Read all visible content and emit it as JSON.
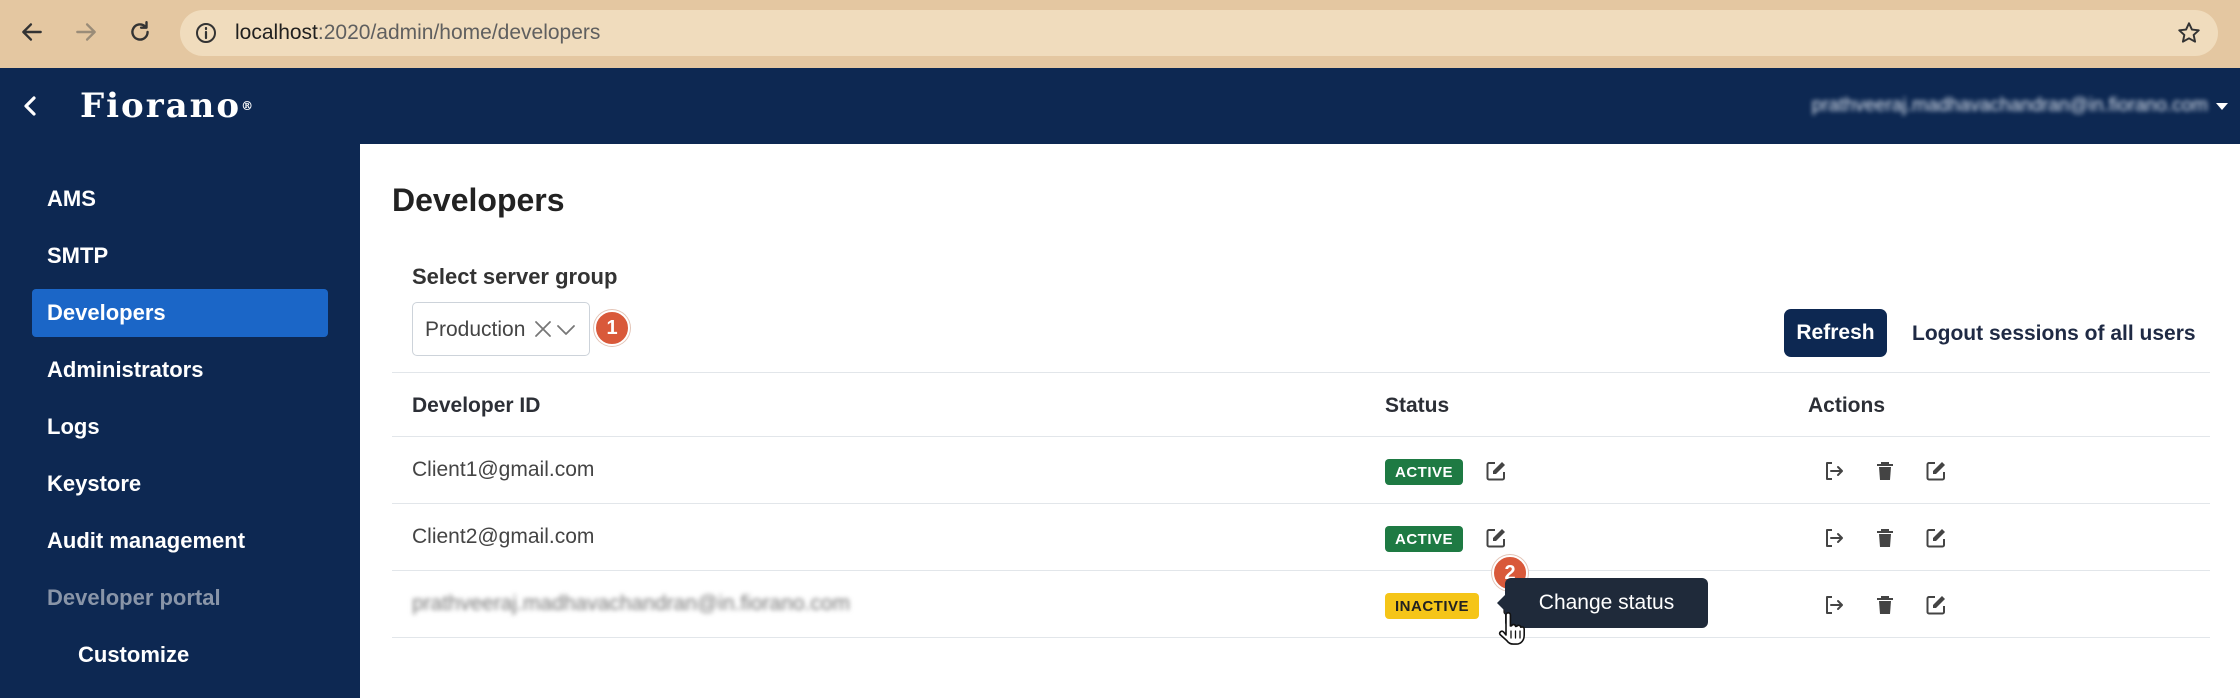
{
  "browser": {
    "url_host": "localhost",
    "url_path": ":2020/admin/home/developers"
  },
  "header": {
    "logo": "Fiorano",
    "logo_mark": "®",
    "user_email": "prathveeraj.madhavachandran@in.fiorano.com"
  },
  "sidebar": {
    "items": [
      {
        "label": "AMS"
      },
      {
        "label": "SMTP"
      },
      {
        "label": "Developers"
      },
      {
        "label": "Administrators"
      },
      {
        "label": "Logs"
      },
      {
        "label": "Keystore"
      },
      {
        "label": "Audit management"
      },
      {
        "label": "Developer portal"
      },
      {
        "label": "Customize"
      }
    ]
  },
  "main": {
    "title": "Developers",
    "server_group_label": "Select server group",
    "server_group_value": "Production",
    "refresh_label": "Refresh",
    "logout_all_label": "Logout sessions of all users",
    "columns": [
      "Developer ID",
      "Status",
      "Actions"
    ],
    "rows": [
      {
        "id": "Client1@gmail.com",
        "status": "ACTIVE"
      },
      {
        "id": "Client2@gmail.com",
        "status": "ACTIVE"
      },
      {
        "id": "prathveeraj.madhavachandran@in.fiorano.com",
        "status": "INACTIVE"
      }
    ],
    "tooltip": "Change status",
    "step_markers": [
      "1",
      "2"
    ]
  },
  "colors": {
    "navy": "#0d2852",
    "active_nav": "#1b66c7",
    "active_status": "#1e7a43",
    "inactive_status": "#f5c518",
    "marker": "#d9593a"
  }
}
